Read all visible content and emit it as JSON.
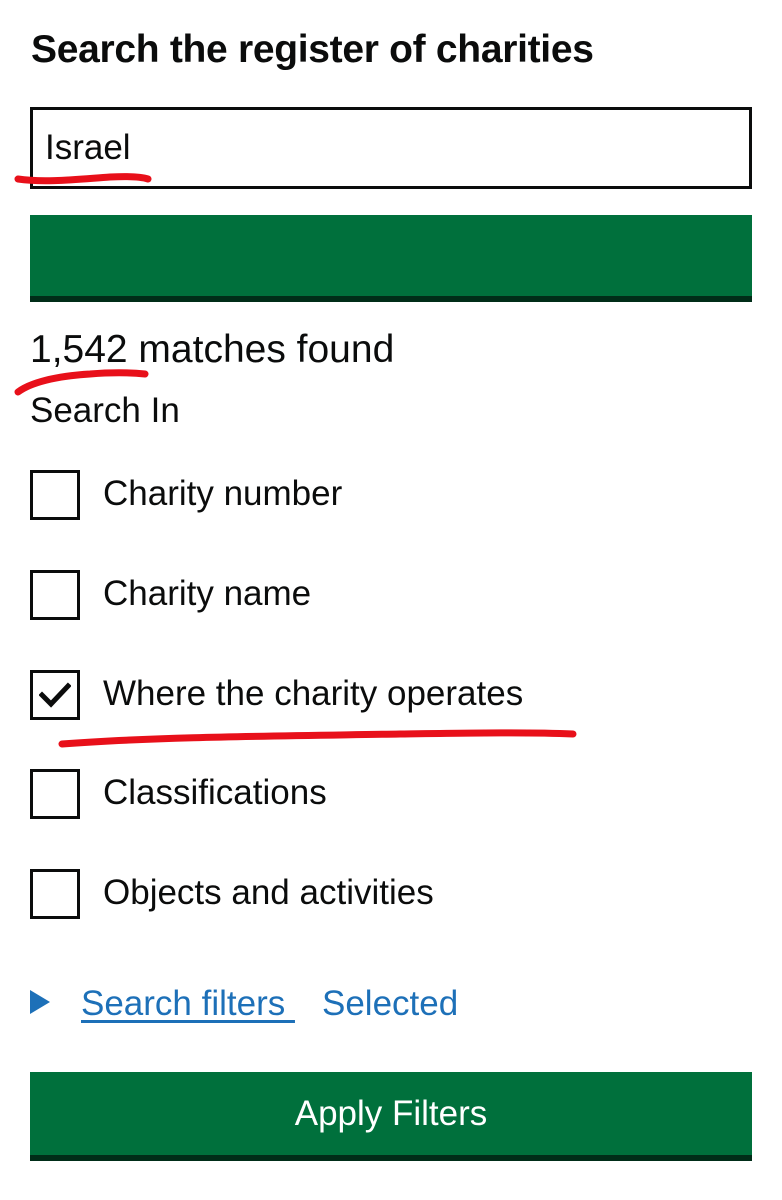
{
  "page": {
    "title": "Search the register of charities"
  },
  "search": {
    "value": "Israel",
    "button_icon": "search-icon"
  },
  "results": {
    "count_text": "1,542 matches found"
  },
  "search_in": {
    "label": "Search In",
    "options": [
      {
        "label": "Charity number",
        "checked": false
      },
      {
        "label": "Charity name",
        "checked": false
      },
      {
        "label": "Where the charity operates",
        "checked": true
      },
      {
        "label": "Classifications",
        "checked": false
      },
      {
        "label": "Objects and activities",
        "checked": false
      }
    ]
  },
  "filters": {
    "link_text": "Search filters ",
    "selected_text": "Selected",
    "icon": "triangle-right-icon"
  },
  "apply_button": {
    "label": "Apply Filters"
  },
  "colors": {
    "button_green": "#00703c",
    "button_shadow": "#002d18",
    "link_blue": "#1d70b8",
    "text": "#0b0c0c",
    "annotation_red": "#e8101a"
  }
}
